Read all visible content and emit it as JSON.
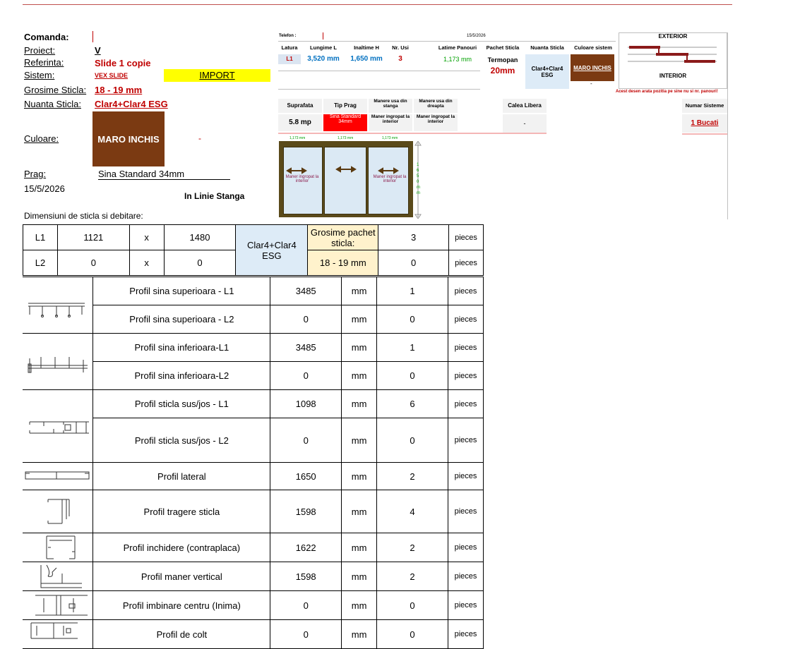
{
  "order": {
    "comanda_label": "Comanda:",
    "proiect_label": "Proiect:",
    "proiect_value": "V",
    "referinta_label": "Referinta:",
    "referinta_value": "Slide 1  copie",
    "sistem_label": "Sistem:",
    "sistem_value": "VEX SLIDE",
    "import_label": "IMPORT",
    "grosime_label": "Grosime Sticla:",
    "grosime_value": "18 - 19 mm",
    "nuanta_label": "Nuanta Sticla:",
    "nuanta_value": "Clar4+Clar4 ESG",
    "culoare_label": "Culoare:",
    "culoare_value": "MARO INCHIS",
    "culoare_dash": "-",
    "prag_label": "Prag:",
    "prag_value": "Sina Standard 34mm",
    "date": "15/5/2026",
    "orientation": "In Linie Stanga",
    "dimensions_title": "Dimensiuni de sticla si debitare:"
  },
  "colors": {
    "accent_red": "#c00000",
    "brown": "#7b3a12",
    "import_yellow": "#ffff00",
    "glass_blue": "#ddebf7",
    "cream": "#fff2cc"
  },
  "summary": {
    "telefon_label": "Telefon :",
    "date": "15/5/2026",
    "headers": [
      "Latura",
      "Lungime L",
      "Inaltime H",
      "Nr. Usi",
      "Latime Panouri",
      "Pachet Sticla",
      "Nuanta Sticla",
      "Culoare sistem"
    ],
    "row": [
      "L1",
      "3,520 mm",
      "1,650 mm",
      "3",
      "1,173 mm"
    ],
    "pachet_line1": "Termopan",
    "pachet_line2": "20mm",
    "nuanta": "Clar4+Clar4 ESG",
    "culoare": "MARO INCHIS",
    "dash": "-",
    "exterior": "EXTERIOR",
    "interior": "INTERIOR",
    "note": "Acest desen arata pozitia pe sine nu si nr. panouri!"
  },
  "second": {
    "suprafata_label": "Suprafata",
    "suprafata_value": "5.8 mp",
    "tip_prag_label": "Tip Prag",
    "tip_prag_value": "Sina Standard 34mm",
    "manere_stanga_label": "Manere usa din stanga",
    "manere_stanga_value": "Maner ingropat la interior",
    "manere_dreapta_label": "Manere usa din dreapta",
    "manere_dreapta_value": "Maner ingropat la interior",
    "calea_label": "Calea Libera",
    "calea_value": "-",
    "numar_label": "Numar Sisteme",
    "numar_value": "1 Bucati"
  },
  "drawing": {
    "panel_widths": [
      "1,173 mm",
      "1,173 mm",
      "1,173 mm"
    ],
    "left_handle": "Maner ingropat la interior",
    "right_handle": "Maner ingropat la interior",
    "height": "1650mm"
  },
  "glass": {
    "rows": [
      {
        "name": "L1",
        "w": "1121",
        "x": "x",
        "h": "1480",
        "qty": "3",
        "unit": "pieces"
      },
      {
        "name": "L2",
        "w": "0",
        "x": "x",
        "h": "0",
        "qty": "0",
        "unit": "pieces"
      }
    ],
    "nuanta": "Clar4+Clar4 ESG",
    "pachet_label": "Grosime pachet sticla:",
    "pachet_value": "18 - 19 mm"
  },
  "profiles": [
    {
      "name": "Profil sina superioara  - L1",
      "len": "3485",
      "unit": "mm",
      "qty": "1",
      "pcs": "pieces"
    },
    {
      "name": "Profil sina superioara  - L2",
      "len": "0",
      "unit": "mm",
      "qty": "0",
      "pcs": "pieces"
    },
    {
      "name": "Profil sina inferioara-L1",
      "len": "3485",
      "unit": "mm",
      "qty": "1",
      "pcs": "pieces"
    },
    {
      "name": "Profil sina inferioara-L2",
      "len": "0",
      "unit": "mm",
      "qty": "0",
      "pcs": "pieces"
    },
    {
      "name": "Profil sticla sus/jos  - L1",
      "len": "1098",
      "unit": "mm",
      "qty": "6",
      "pcs": "pieces"
    },
    {
      "name": "Profil sticla sus/jos  - L2",
      "len": "0",
      "unit": "mm",
      "qty": "0",
      "pcs": "pieces"
    },
    {
      "name": "Profil lateral",
      "len": "1650",
      "unit": "mm",
      "qty": "2",
      "pcs": "pieces"
    },
    {
      "name": "Profil tragere sticla",
      "len": "1598",
      "unit": "mm",
      "qty": "4",
      "pcs": "pieces"
    },
    {
      "name": "Profil inchidere (contraplaca)",
      "len": "1622",
      "unit": "mm",
      "qty": "2",
      "pcs": "pieces"
    },
    {
      "name": "Profil maner vertical",
      "len": "1598",
      "unit": "mm",
      "qty": "2",
      "pcs": "pieces"
    },
    {
      "name": "Profil imbinare centru (Inima)",
      "len": "0",
      "unit": "mm",
      "qty": "0",
      "pcs": "pieces"
    },
    {
      "name": "Profil de colt",
      "len": "0",
      "unit": "mm",
      "qty": "0",
      "pcs": "pieces"
    }
  ]
}
